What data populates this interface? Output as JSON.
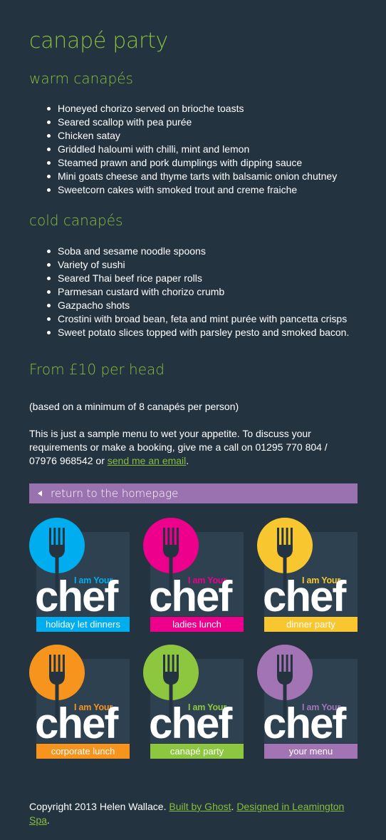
{
  "page": {
    "title": "canapé party"
  },
  "warm": {
    "heading": "warm canapés",
    "items": [
      "Honeyed chorizo served on brioche toasts",
      "Seared scallop with pea purée",
      "Chicken satay",
      "Griddled haloumi with chilli, mint and lemon",
      "Steamed prawn and pork dumplings with dipping sauce",
      "Mini goats cheese and thyme tarts with balsamic onion chutney",
      "Sweetcorn cakes with smoked trout and creme fraiche"
    ]
  },
  "cold": {
    "heading": "cold canapés",
    "items": [
      "Soba and sesame noodle spoons",
      "Variety of sushi",
      "Seared Thai beef rice paper rolls",
      "Parmesan custard with chorizo crumb",
      "Gazpacho shots",
      "Crostini with broad bean, feta and mint purée with pancetta crisps",
      "Sweet potato slices topped with parsley pesto and smoked bacon."
    ]
  },
  "pricing": {
    "heading": "From £10 per head",
    "minimum_note": "(based on a minimum of 8 canapés per person)",
    "sample_text": "This is just a sample menu to wet your appetite. To discuss your requirements or make a booking, give me a call on 01295 770 804 / 07976 968542 or ",
    "email_link": "send me an email",
    "sample_end": "."
  },
  "nav": {
    "return_label": "return to the homepage",
    "return_icon": "triangle-left-icon"
  },
  "brand": {
    "i_am_your": "I am Your",
    "chef": "chef"
  },
  "tiles": [
    {
      "label": "holiday let dinners",
      "color": "#00aeef"
    },
    {
      "label": "ladies lunch",
      "color": "#ec008c"
    },
    {
      "label": "dinner party",
      "color": "#f8c72f"
    },
    {
      "label": "corporate lunch",
      "color": "#f7941d"
    },
    {
      "label": "canapé party",
      "color": "#8dc63f"
    },
    {
      "label": "your menu",
      "color": "#a374b3"
    }
  ],
  "footer": {
    "copyright": "Copyright 2013 Helen Wallace. ",
    "built_by": "Built by Ghost",
    "separator": ". ",
    "designed_in": "Designed in Leamington Spa",
    "end": "."
  },
  "colors": {
    "background": "#243340",
    "accent_green": "#86bd3e",
    "return_bar": "#9b72b0",
    "tile_panel": "#2e4150"
  }
}
